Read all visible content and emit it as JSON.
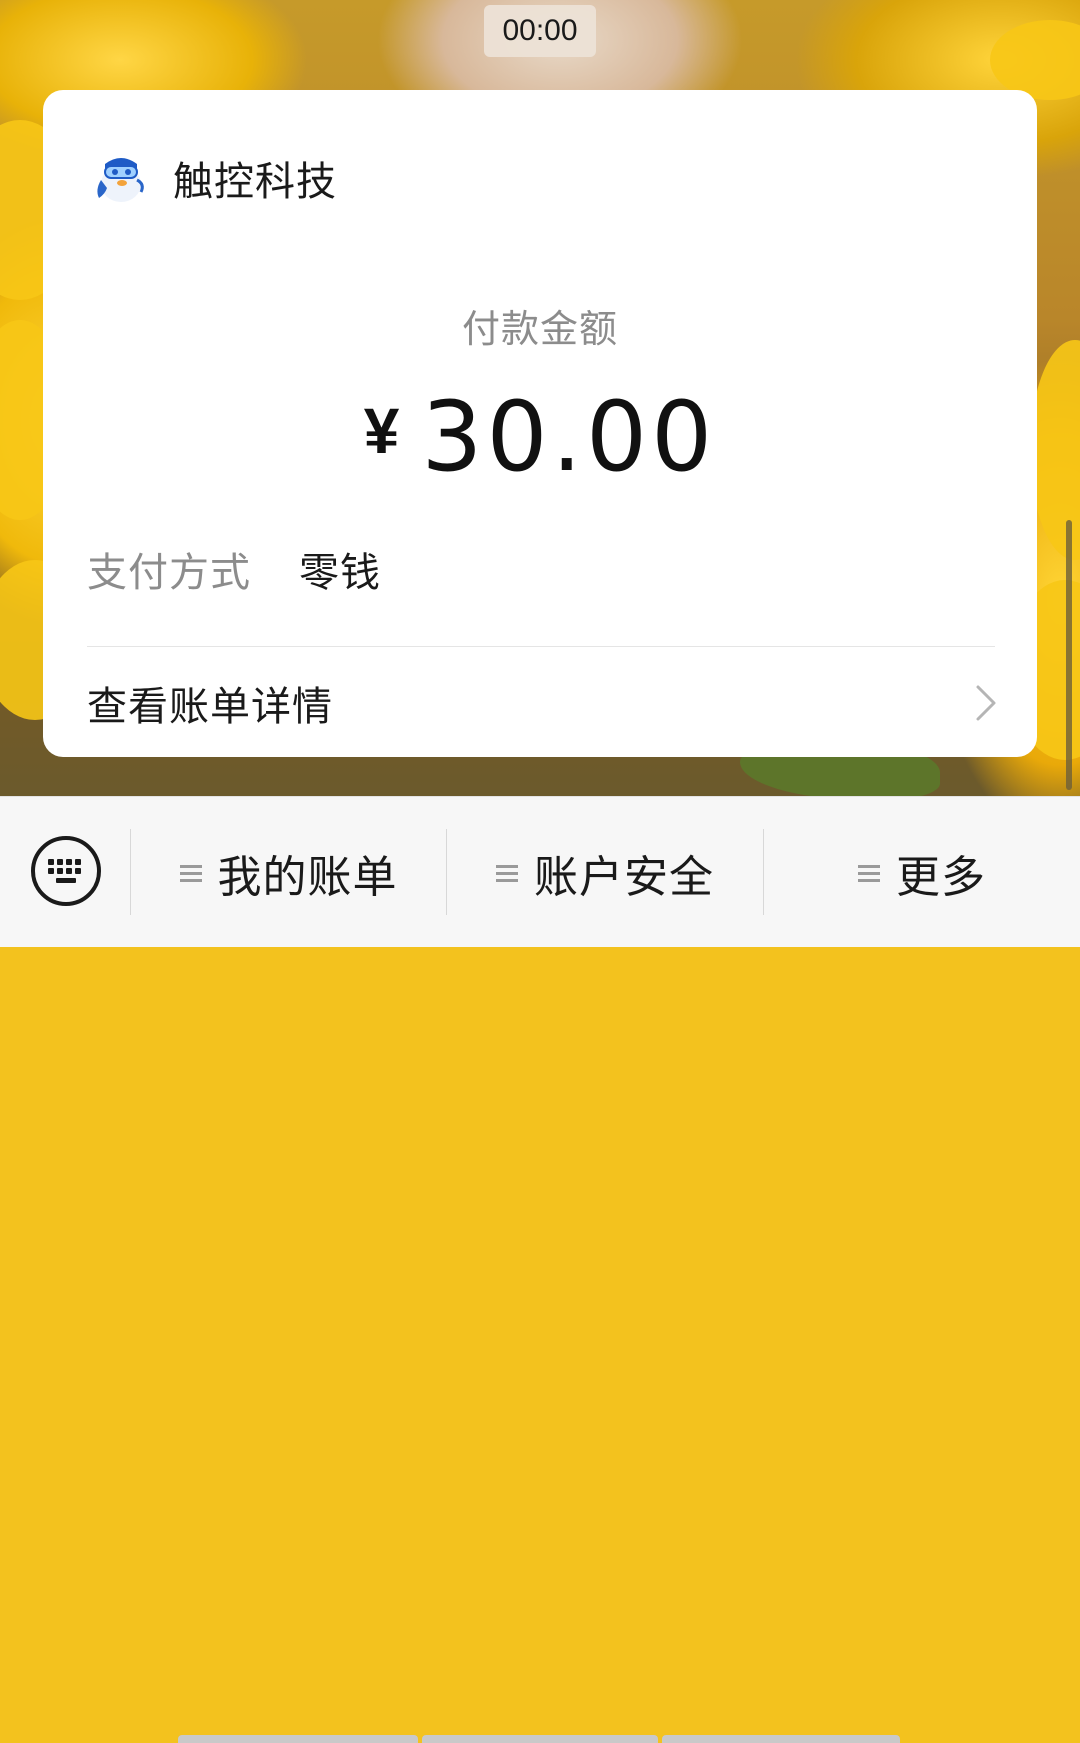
{
  "message": {
    "timestamp": "00:00"
  },
  "payment_card": {
    "merchant_name": "触控科技",
    "merchant_logo_icon": "merchant-mascot-icon",
    "amount_label": "付款金额",
    "currency_symbol": "¥",
    "amount": "30.00",
    "pay_method_label": "支付方式",
    "pay_method_value": "零钱",
    "bill_detail_label": "查看账单详情"
  },
  "menu": {
    "keyboard_icon": "keyboard-icon",
    "items": [
      {
        "label": "我的账单",
        "icon": "hamburger-icon"
      },
      {
        "label": "账户安全",
        "icon": "hamburger-icon"
      },
      {
        "label": "更多",
        "icon": "hamburger-icon"
      }
    ]
  },
  "colors": {
    "card_bg": "#ffffff",
    "label_gray": "#8c8c8c",
    "text_dark": "#1a1a1a",
    "menu_bg": "#f7f7f7"
  }
}
